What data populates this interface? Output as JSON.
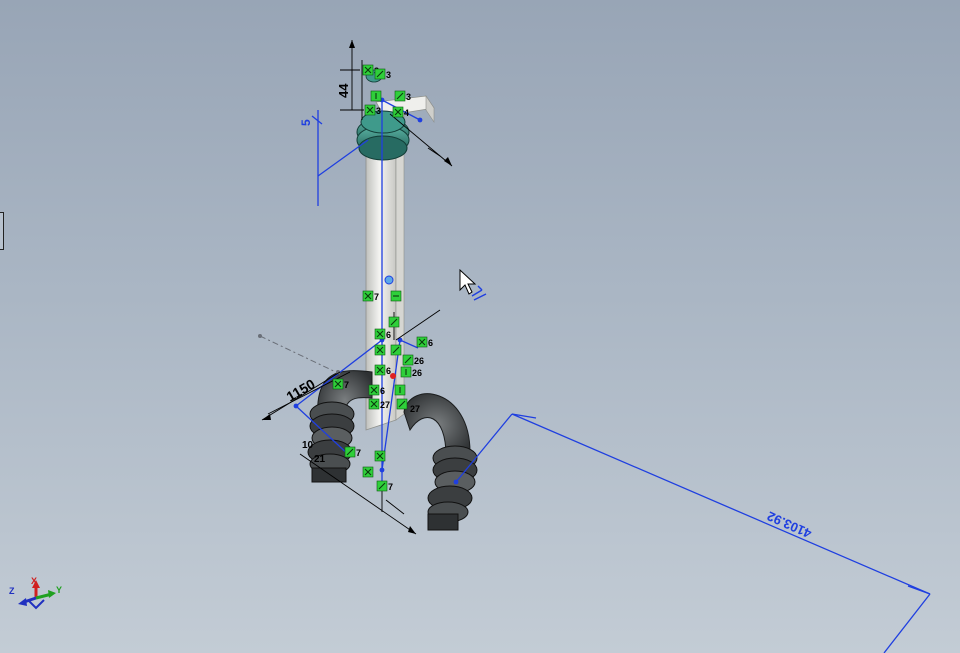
{
  "window": {
    "app_area": "solidworks-3d-sketch-viewport"
  },
  "colors": {
    "background_top": "#98a5b6",
    "background_bottom": "#c3ccd5",
    "sketch_blue": "#1f3fe0",
    "relation_green": "#2fcf3a",
    "pipe_body": "#e8e8e4",
    "fitting_dark": "#3e4244",
    "fitting_teal": "#2e7a70",
    "dimension_black": "#000000"
  },
  "dimensions": {
    "top_44": "44",
    "top_5": "5",
    "bottom_1150": "1150",
    "long_4103": "4103.92",
    "label_10": "10",
    "label_21": "21",
    "label_27": "27"
  },
  "relations": [
    {
      "glyph": "x",
      "num": "3"
    },
    {
      "glyph": "slash",
      "num": "3"
    },
    {
      "glyph": "vert",
      "num": ""
    },
    {
      "glyph": "slash",
      "num": "3"
    },
    {
      "glyph": "x",
      "num": "3"
    },
    {
      "glyph": "x",
      "num": "4"
    },
    {
      "glyph": "x",
      "num": "7"
    },
    {
      "glyph": "horiz",
      "num": ""
    },
    {
      "glyph": "x",
      "num": "6"
    },
    {
      "glyph": "slash",
      "num": ""
    },
    {
      "glyph": "x",
      "num": ""
    },
    {
      "glyph": "slash",
      "num": ""
    },
    {
      "glyph": "x",
      "num": "6"
    },
    {
      "glyph": "slash",
      "num": "26"
    },
    {
      "glyph": "x",
      "num": "6"
    },
    {
      "glyph": "vert",
      "num": "26"
    },
    {
      "glyph": "x",
      "num": "6"
    },
    {
      "glyph": "x",
      "num": "27"
    },
    {
      "glyph": "vert",
      "num": ""
    },
    {
      "glyph": "slash",
      "num": ""
    },
    {
      "glyph": "x",
      "num": "7"
    },
    {
      "glyph": "slash",
      "num": "7"
    },
    {
      "glyph": "x",
      "num": ""
    },
    {
      "glyph": "x",
      "num": ""
    },
    {
      "glyph": "slash",
      "num": "7"
    }
  ],
  "triad": {
    "x_label": "X",
    "y_label": "Y",
    "z_label": "Z"
  },
  "cursor": {
    "icon": "arrow-pointer-icon",
    "badge": "3d-sketch-cursor-icon"
  }
}
